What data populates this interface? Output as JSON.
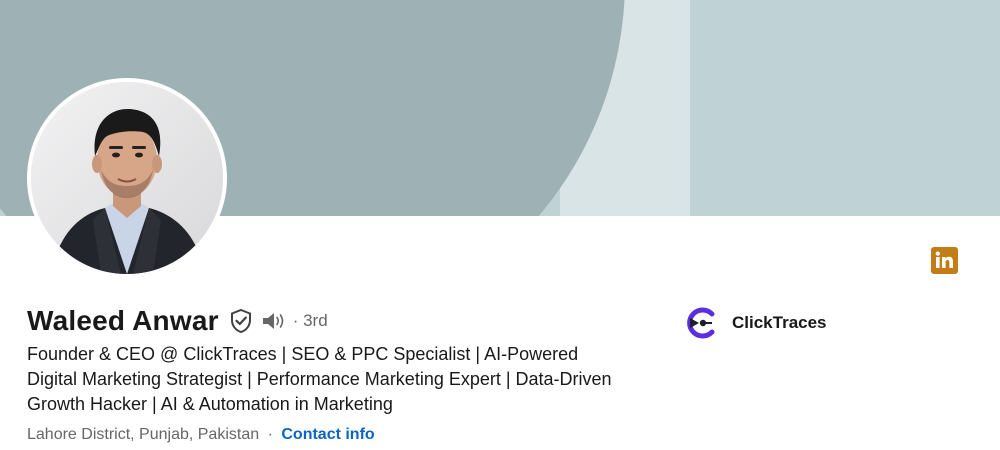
{
  "profile": {
    "name": "Waleed Anwar",
    "degree": "· 3rd",
    "headline": "Founder & CEO @ ClickTraces | SEO & PPC Specialist | AI-Powered Digital Marketing Strategist | Performance Marketing Expert | Data-Driven Growth Hacker | AI & Automation in Marketing",
    "location": "Lahore District, Punjab, Pakistan",
    "location_separator": "·",
    "contact_label": "Contact info"
  },
  "company": {
    "name": "ClickTraces",
    "logo_icon": "clicktraces-logo"
  },
  "icons": {
    "verified": "verified-shield-icon",
    "pronunciation": "speaker-icon",
    "social": "linkedin-icon"
  },
  "colors": {
    "link": "#0a66c2",
    "linkedin_badge": "#c37d16",
    "banner_dark": "#9eb2b6",
    "banner_light": "#bfd2d6"
  }
}
